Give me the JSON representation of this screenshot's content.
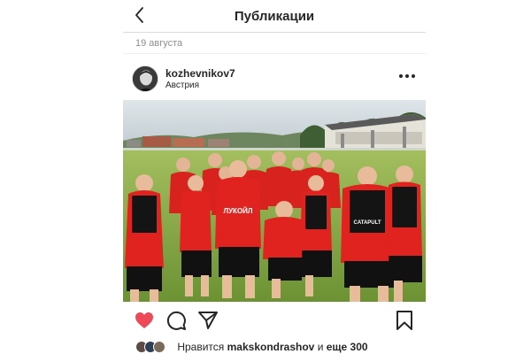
{
  "header": {
    "title": "Публикации"
  },
  "post": {
    "date": "19 августа",
    "username": "kozhevnikov7",
    "location": "Австрия",
    "photo": {
      "shirt_text": "ЛУКОЙЛ",
      "bib_text": "CATAPULT",
      "shirt_color": "#e0231f",
      "bib_color": "#141414",
      "sky_color": "#cfd8dc",
      "grass_color": "#86a94a"
    },
    "likes": {
      "prefix": "Нравится",
      "user": "makskondrashov",
      "connector": "и",
      "others": "еще 300"
    }
  },
  "icons": {
    "back": "chevron-left-icon",
    "more": "more-horizontal-icon",
    "like": "heart-filled-icon",
    "comment": "comment-icon",
    "share": "send-icon",
    "save": "bookmark-icon"
  },
  "colors": {
    "heart": "#ed4956",
    "text": "#262626",
    "muted": "#8e8e8e"
  }
}
